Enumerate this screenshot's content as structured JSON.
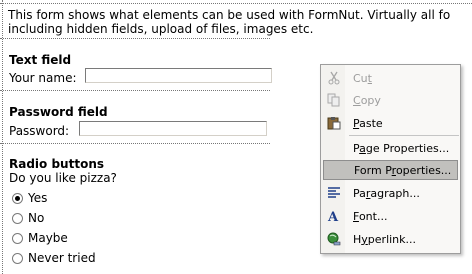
{
  "intro": {
    "line1": "This form shows what elements can be used with FormNut. Virtually all fo",
    "line2": "including hidden fields, upload of files, images etc."
  },
  "text_field": {
    "heading": "Text field",
    "label": "Your name:",
    "value": ""
  },
  "password_field": {
    "heading": "Password field",
    "label": "Password:",
    "value": ""
  },
  "radio_buttons": {
    "heading": "Radio buttons",
    "question": "Do you like pizza?",
    "options": [
      {
        "label": "Yes",
        "checked": true
      },
      {
        "label": "No",
        "checked": false
      },
      {
        "label": "Maybe",
        "checked": false
      },
      {
        "label": "Never tried",
        "checked": false
      }
    ]
  },
  "context_menu": {
    "items": [
      {
        "label": "Cut",
        "mnemonic": "t",
        "icon": "scissors-icon",
        "disabled": true
      },
      {
        "label": "Copy",
        "mnemonic": "C",
        "icon": "copy-icon",
        "disabled": true
      },
      {
        "label": "Paste",
        "mnemonic": "P",
        "icon": "clipboard-icon",
        "disabled": false
      },
      {
        "label": "Page Properties...",
        "icon": "none",
        "disabled": false
      },
      {
        "label": "Form Properties...",
        "icon": "none",
        "disabled": false,
        "highlighted": true
      },
      {
        "label": "Paragraph...",
        "icon": "paragraph-icon",
        "disabled": false
      },
      {
        "label": "Font...",
        "icon": "font-icon",
        "disabled": false
      },
      {
        "label": "Hyperlink...",
        "icon": "globe-link-icon",
        "disabled": false
      }
    ]
  },
  "colors": {
    "menu_background": "#f9f8f6",
    "menu_highlight": "#c1c0bd",
    "disabled_text": "#9d9d9d"
  }
}
